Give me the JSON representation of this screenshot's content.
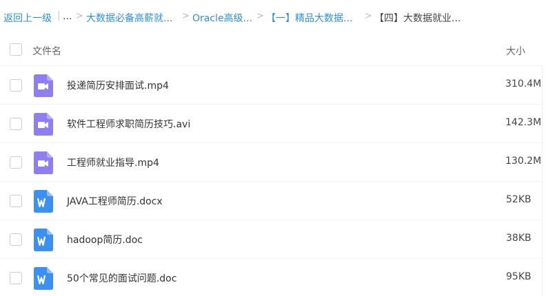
{
  "breadcrumb": {
    "back": "返回上一级",
    "separator_bar": "|",
    "ellipsis": "...",
    "sep": ">",
    "items": [
      "大数据必备高薪就...",
      "Oracle高级...",
      "【一】精品大数据..."
    ],
    "current": "【四】大数据就业..."
  },
  "header": {
    "name_label": "文件名",
    "size_label": "大小"
  },
  "files": [
    {
      "name": "投递简历安排面试.mp4",
      "size": "310.4M",
      "icon": "video-file-icon",
      "color": "#8f7ef0"
    },
    {
      "name": "软件工程师求职简历技巧.avi",
      "size": "142.3M",
      "icon": "video-file-icon",
      "color": "#8f7ef0"
    },
    {
      "name": "工程师就业指导.mp4",
      "size": "130.2M",
      "icon": "video-file-icon",
      "color": "#8f7ef0"
    },
    {
      "name": "JAVA工程师简历.docx",
      "size": "52KB",
      "icon": "word-doc-icon",
      "color": "#3d8ff0"
    },
    {
      "name": "hadoop简历.doc",
      "size": "38KB",
      "icon": "word-doc-icon",
      "color": "#3d8ff0"
    },
    {
      "name": "50个常见的面试问题.doc",
      "size": "95KB",
      "icon": "word-doc-icon",
      "color": "#3d8ff0"
    }
  ]
}
